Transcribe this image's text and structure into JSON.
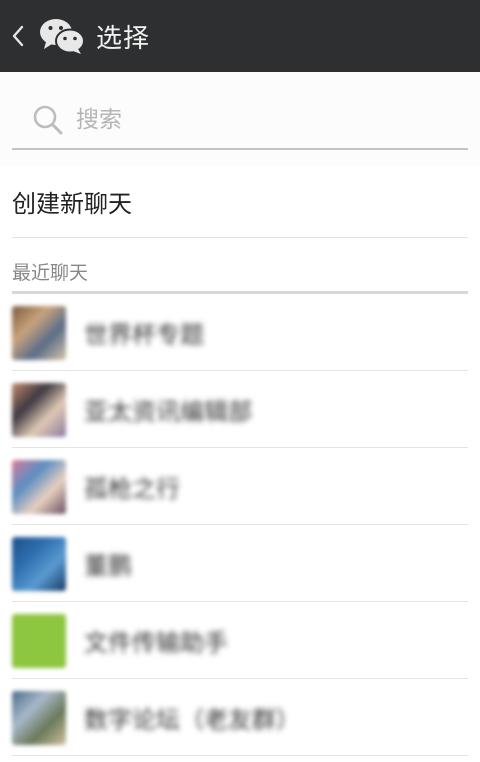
{
  "titlebar": {
    "title": "选择"
  },
  "search": {
    "placeholder": "搜索"
  },
  "actions": {
    "new_chat_label": "创建新聊天"
  },
  "recent": {
    "header": "最近聊天",
    "chats": [
      {
        "name": "世界杯专题",
        "avatar_colors": [
          "#7a5a3e",
          "#c9a27c",
          "#5b6e8a",
          "#d8c2a8"
        ]
      },
      {
        "name": "亚太资讯编辑部",
        "avatar_colors": [
          "#c48a6a",
          "#3e3a44",
          "#e0c9b4",
          "#8a7aa0"
        ]
      },
      {
        "name": "孤枪之行",
        "avatar_colors": [
          "#d77a9a",
          "#5c8fc2",
          "#e8d0c0",
          "#6a4e60"
        ]
      },
      {
        "name": "董鹏",
        "avatar_colors": [
          "#1d4f8a",
          "#2e6fb0",
          "#5a9ad0",
          "#163a66"
        ]
      },
      {
        "name": "文件传输助手",
        "avatar_colors": [
          "#8dc63f",
          "#8dc63f",
          "#8dc63f",
          "#8dc63f"
        ]
      },
      {
        "name": "数字论坛（老友群）",
        "avatar_colors": [
          "#4a6a8a",
          "#a8b8c8",
          "#6a7a5a",
          "#d0c0a0"
        ]
      }
    ]
  }
}
